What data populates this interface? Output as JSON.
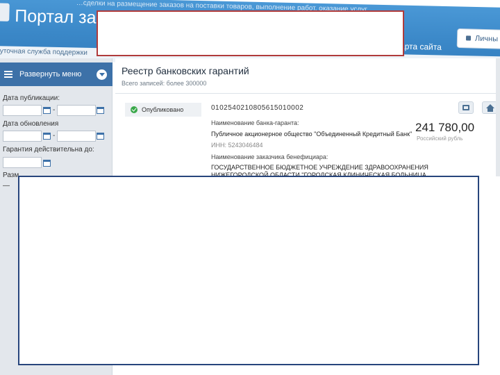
{
  "header": {
    "tagline": "…сделки на размещение заказов на поставки товаров, выполнение работ, оказание услуг",
    "portal_title": "Портал заку",
    "site_map": "карта сайта",
    "personal_cabinet": "Личны",
    "support_text": "уточная служба поддержки"
  },
  "sidebar": {
    "menu_toggle": "Развернуть меню",
    "publication_date_label": "Дата публикации:",
    "update_date_label": "Дата обновления",
    "valid_until_label": "Гарантия действительна до:",
    "amount_label": "Разм",
    "dash": "-",
    "dash_small": "—"
  },
  "main": {
    "title": "Реестр банковских гарантий",
    "total_records": "Всего записей: более 300000",
    "record": {
      "status": "Опубликовано",
      "reg_number": "0102540210805615010002",
      "bank_label": "Наименование банка-гаранта:",
      "bank_value": "Публичное акционерное общество \"Объединенный Кредитный Банк\"",
      "inn": "ИНН: 5243046484",
      "beneficiary_label": "Наименование заказчика бенефициара:",
      "beneficiary_line1": "ГОСУДАРСТВЕННОЕ БЮДЖЕТНОЕ УЧРЕЖДЕНИЕ ЗДРАВООХРАНЕНИЯ",
      "beneficiary_line2": "НИЖЕГОРОДСКОЙ ОБЛАСТИ \"ГОРОДСКАЯ КЛИНИЧЕСКАЯ БОЛЬНИЦА",
      "amount": "241 780,00",
      "currency": "Российский рубль"
    }
  },
  "icons": {
    "print": "printer-icon",
    "home": "home-icon",
    "calendar": "calendar-icon",
    "check": "check-circle-icon",
    "menu": "hamburger-icon",
    "chevron": "chevron-down-icon",
    "lock": "lock-icon"
  },
  "colors": {
    "header_blue": "#3b88c8",
    "menu_blue": "#3d71a8",
    "status_green": "#3aa84a",
    "annotation_red": "#b03b3b",
    "annotation_navy": "#27457c"
  }
}
